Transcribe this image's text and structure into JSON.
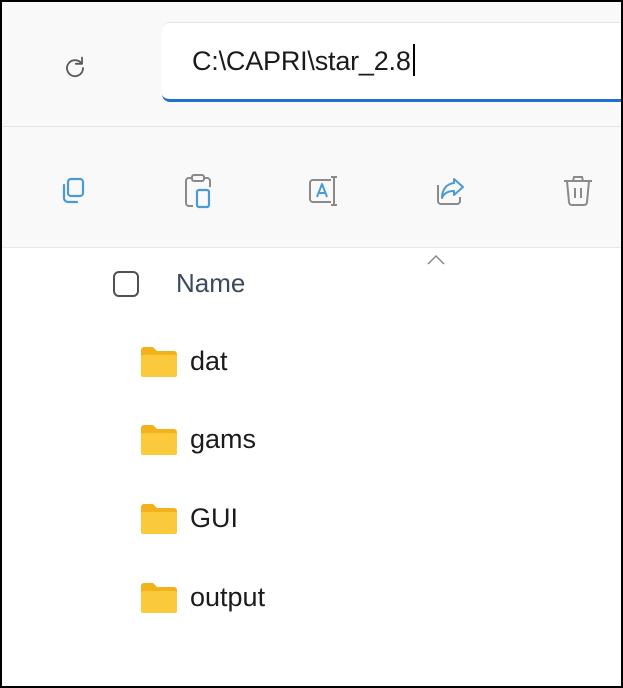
{
  "address_bar": {
    "path": "C:\\CAPRI\\star_2.8"
  },
  "icons": {
    "refresh": "refresh-icon",
    "copy": "copy-icon",
    "paste": "paste-icon",
    "rename": "rename-icon",
    "share": "share-icon",
    "delete": "delete-icon",
    "folder": "folder-icon",
    "sort": "sort-ascending-icon"
  },
  "file_list": {
    "header_name": "Name",
    "items": [
      {
        "name": "dat"
      },
      {
        "name": "gams"
      },
      {
        "name": "GUI"
      },
      {
        "name": "output"
      }
    ]
  },
  "colors": {
    "accent": "#1d6fd6",
    "folder": "#f8c434"
  }
}
